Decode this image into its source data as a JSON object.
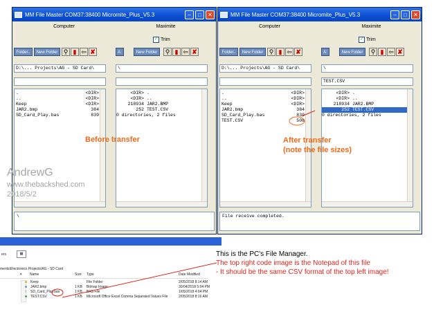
{
  "window_left": {
    "title": "MM File Master  COM37:38400  Micromite_Plus_V5.3",
    "computer": {
      "header": "Computer",
      "folder_btn": "Folder..",
      "new_folder_btn": "New Folder",
      "path": "D:\\... Projects\\AG - SD Card\\",
      "filter": "",
      "files": [
        {
          "name": ".",
          "size": "<DIR>"
        },
        {
          "name": "..",
          "size": "<DIR>"
        },
        {
          "name": "Keep",
          "size": "<DIR>"
        },
        {
          "name": "JAR2.bmp",
          "size": "384"
        },
        {
          "name": "SD_Card_Play.bas",
          "size": "839"
        }
      ]
    },
    "micromite": {
      "header": "Maximite",
      "trim_label": "Trim",
      "a_btn": "A:",
      "new_folder_btn": "New Folder",
      "path": "\\",
      "filter": "",
      "files": [
        {
          "num": "<DIR>",
          "name": "."
        },
        {
          "num": "<DIR>",
          "name": ".."
        },
        {
          "num": "218934",
          "name": "JAR2.BMP"
        },
        {
          "num": "252",
          "name": "TEST.CSV"
        },
        {
          "num": "",
          "name": "0 directories, 2 files"
        }
      ]
    },
    "status": "\\"
  },
  "window_right": {
    "title": "MM File Master  COM37:38400  Micromite_Plus_V5.3",
    "computer": {
      "header": "Computer",
      "folder_btn": "Folder..",
      "new_folder_btn": "New Folder",
      "path": "D:\\... Projects\\AG - SD Card\\",
      "filter": "",
      "files": [
        {
          "name": ".",
          "size": "<DIR>"
        },
        {
          "name": "..",
          "size": "<DIR>"
        },
        {
          "name": "Keep",
          "size": "<DIR>"
        },
        {
          "name": "JAR2.bmp",
          "size": "384"
        },
        {
          "name": "SD_Card_Play.bas",
          "size": "839"
        },
        {
          "name": "TEST.CSV",
          "size": "508"
        }
      ]
    },
    "micromite": {
      "header": "Maximite",
      "trim_label": "Trim",
      "a_btn": "A:",
      "new_folder_btn": "New Folder",
      "path": "\\",
      "filter": "TEST.CSV",
      "files": [
        {
          "num": "<DIR>",
          "name": "."
        },
        {
          "num": "<DIR>",
          "name": ".."
        },
        {
          "num": "218934",
          "name": "JAR2.BMP"
        },
        {
          "num": "252",
          "name": "TEST.CSV"
        },
        {
          "num": "",
          "name": "0 directories, 2 files"
        }
      ]
    },
    "status": "File receive completed."
  },
  "annotations": {
    "before": "Before transfer",
    "after_line1": "After transfer",
    "after_line2": "(note the file sizes)",
    "watermark_name": "AndrewG",
    "watermark_site": "www.thebackshed.com",
    "watermark_date": "2018/5/2",
    "accent_color": "#f26a19"
  },
  "explorer": {
    "toolbar_label": "ers",
    "path": "ments\\Electronics Projects\\AG - SD Card",
    "columns": [
      "Name",
      "Size",
      "Type",
      "Date Modified"
    ],
    "rows": [
      {
        "name": "Keep",
        "size": "",
        "type": "File Folder",
        "date": "2/05/2018 8:14 AM"
      },
      {
        "name": "JAR2.bmp",
        "size": "1 KB",
        "type": "Bitmap Image",
        "date": "30/04/2018 5:04 PM"
      },
      {
        "name": "SD_Card_Play.bas",
        "size": "1 KB",
        "type": "BAS File",
        "date": "1/05/2018 4:04 PM"
      },
      {
        "name": "TEST.CSV",
        "size": "1 KB",
        "type": "Microsoft Office Excel Comma Separated Values File",
        "date": "2/05/2018 8:16 AM"
      }
    ]
  },
  "notes": {
    "line1": "This is the PC's File Manager.",
    "line2": "The top right code image is the Notepad of this file",
    "line3": "- It should be the same CSV format of the top left image!"
  }
}
